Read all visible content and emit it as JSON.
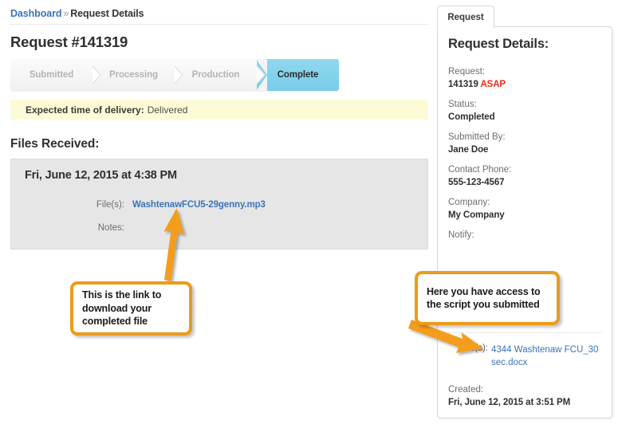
{
  "breadcrumb": {
    "parent": "Dashboard",
    "separator": "»",
    "current": "Request Details"
  },
  "page": {
    "title": "Request #141319"
  },
  "progress": {
    "steps": [
      {
        "label": "Submitted",
        "state": "inactive"
      },
      {
        "label": "Processing",
        "state": "inactive"
      },
      {
        "label": "Production",
        "state": "inactive"
      },
      {
        "label": "Complete",
        "state": "active"
      }
    ],
    "active_color": "#79cde9",
    "inactive_color": "#f0f0f0"
  },
  "delivery_notice": {
    "label": "Expected time of delivery:",
    "value": "Delivered",
    "background_color": "#fcfbd6"
  },
  "files_received": {
    "heading": "Files Received:",
    "date": "Fri, June 12, 2015 at 4:38 PM",
    "rows": [
      {
        "label": "File(s):",
        "value": "WashtenawFCU5-29genny.mp3",
        "is_link": true
      },
      {
        "label": "Notes:",
        "value": "",
        "is_link": false
      }
    ],
    "panel_color": "#e6e6e6"
  },
  "right_panel": {
    "tab_label": "Request",
    "title": "Request Details:",
    "fields": [
      {
        "label": "Request:",
        "value": "141319",
        "badge": "ASAP",
        "badge_color": "#ef2a18"
      },
      {
        "label": "Status:",
        "value": "Completed"
      },
      {
        "label": "Submitted By:",
        "value": "Jane Doe"
      },
      {
        "label": "Contact Phone:",
        "value": "555-123-4567"
      },
      {
        "label": "Company:",
        "value": "My Company"
      },
      {
        "label": "Notify:",
        "value": ""
      }
    ],
    "file_row": {
      "label": "File(s):",
      "value": "4344 Washtenaw FCU_30 sec.docx",
      "link_color": "#3b73b9"
    },
    "created": {
      "label": "Created:",
      "value": "Fri, June 12, 2015 at 3:51 PM"
    }
  },
  "annotations": {
    "accent_color": "#eb9b1b",
    "callouts": [
      {
        "id": "download",
        "text": "This is the link to\ndownload your\ncompleted file"
      },
      {
        "id": "script",
        "text": "Here you have access to\nthe script you submitted"
      }
    ]
  }
}
